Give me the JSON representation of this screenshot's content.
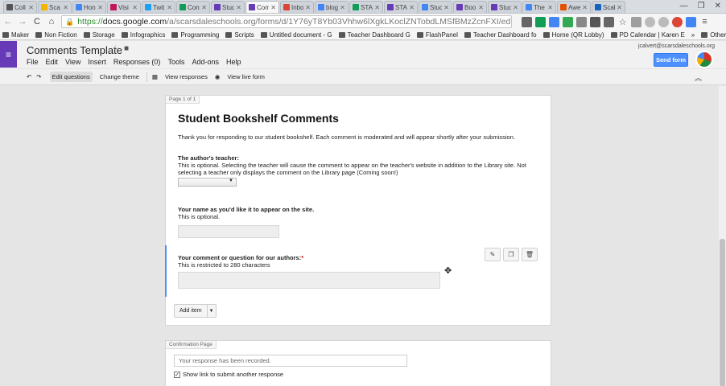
{
  "tabs": [
    {
      "label": "Coll",
      "color": "#555555",
      "active": false
    },
    {
      "label": "Sca",
      "color": "#f4b400",
      "active": false
    },
    {
      "label": "Hon",
      "color": "#4285f4",
      "active": false
    },
    {
      "label": "Visi",
      "color": "#c2185b",
      "active": false
    },
    {
      "label": "Twit",
      "color": "#1da1f2",
      "active": false
    },
    {
      "label": "Con",
      "color": "#0f9d58",
      "active": false
    },
    {
      "label": "Stud",
      "color": "#673ab7",
      "active": false
    },
    {
      "label": "Com",
      "color": "#673ab7",
      "active": true
    },
    {
      "label": "Inbo",
      "color": "#db4437",
      "active": false
    },
    {
      "label": "blog",
      "color": "#4285f4",
      "active": false
    },
    {
      "label": "STA",
      "color": "#0f9d58",
      "active": false
    },
    {
      "label": "STA",
      "color": "#673ab7",
      "active": false
    },
    {
      "label": "Stuc",
      "color": "#4285f4",
      "active": false
    },
    {
      "label": "Boo",
      "color": "#673ab7",
      "active": false
    },
    {
      "label": "Stuc",
      "color": "#673ab7",
      "active": false
    },
    {
      "label": "The",
      "color": "#4285f4",
      "active": false
    },
    {
      "label": "Awe",
      "color": "#e65100",
      "active": false
    },
    {
      "label": "Scal",
      "color": "#1565c0",
      "active": false
    }
  ],
  "omnibox": {
    "proto": "https://",
    "host": "docs.google.com",
    "path": "/a/scarsdaleschools.org/forms/d/1Y76yT8Yb03Vhhw6lXgkLKoclZNTobdLMSfBMzZcnFXI/edit"
  },
  "bookmarks": [
    "Maker",
    "Non Fiction",
    "Storage",
    "Infographics",
    "Programming",
    "Scripts",
    "Untitled document - G",
    "Teacher Dashboard G",
    "FlashPanel",
    "Teacher Dashboard fo",
    "Home (QR Lobby)",
    "PD Calendar | Karen E"
  ],
  "bookmarks_more": "»",
  "bookmarks_other": "Other bookmarks",
  "header": {
    "title": "Comments Template",
    "menu": [
      "File",
      "Edit",
      "View",
      "Insert",
      "Responses (0)",
      "Tools",
      "Add-ons",
      "Help"
    ],
    "account": "jcalvert@scarsdaleschools.org",
    "send_label": "Send form"
  },
  "toolbar": {
    "edit_questions": "Edit questions",
    "change_theme": "Change theme",
    "view_responses": "View responses",
    "view_live": "View live form"
  },
  "form": {
    "page_label": "Page 1 of 1",
    "title": "Student Bookshelf Comments",
    "description": "Thank you for responding to our student bookshelf. Each comment is moderated and will appear shortly after your submission.",
    "q1_title": "The author's teacher:",
    "q1_help": "This is optional. Selecting the teacher will cause the comment to appear on the teacher's website in addition to the Library site. Not selecting a teacher only displays the comment on the Library page (Coming soon!)",
    "q2_title": "Your name as you'd like it to appear on the site.",
    "q2_help": "This is optional.",
    "q3_title": "Your comment or question for our authors:",
    "q3_required": "*",
    "q3_help": "This is restricted to 280 characters",
    "add_item": "Add item"
  },
  "confirmation": {
    "label": "Confirmation Page",
    "message": "Your response has been recorded.",
    "show_link": "Show link to submit another response",
    "show_link_checked": true
  }
}
